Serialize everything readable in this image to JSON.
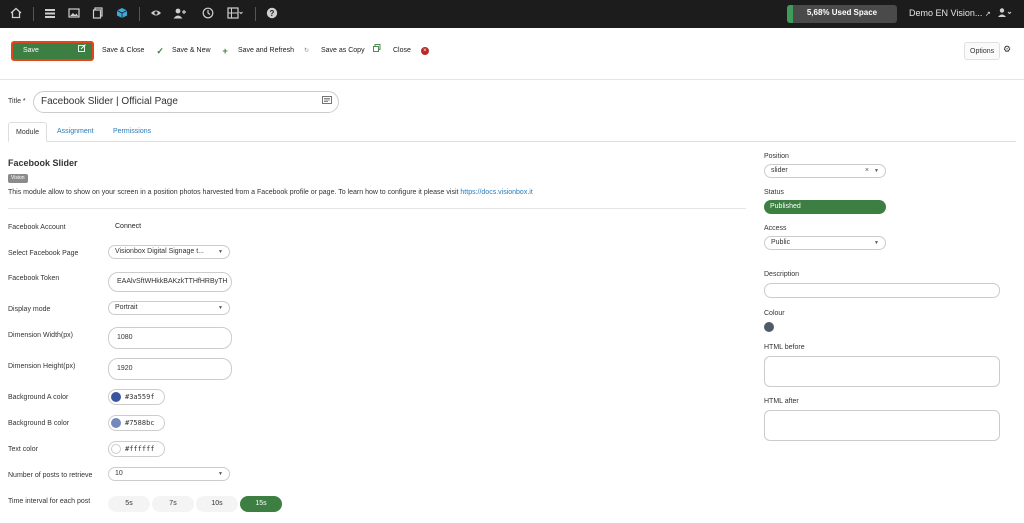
{
  "topbar": {
    "icons": [
      "home-icon",
      "list-icon",
      "image-icon",
      "copy-icon",
      "cube-icon",
      "eye-icon",
      "user-add-icon",
      "clock-icon",
      "layout-icon",
      "help-icon"
    ],
    "used_space": "5,68% Used Space",
    "used_space_percent": 5.68,
    "site_name": "Demo EN Vision...",
    "user_icon": "user-icon"
  },
  "toolbar": {
    "save": "Save",
    "save_close": "Save & Close",
    "save_new": "Save & New",
    "save_refresh": "Save and Refresh",
    "save_copy": "Save as Copy",
    "close": "Close",
    "options": "Options"
  },
  "title": {
    "label": "Title *",
    "value": "Facebook Slider | Official Page"
  },
  "tabs": [
    "Module",
    "Assignment",
    "Permissions"
  ],
  "module": {
    "heading": "Facebook Slider",
    "badge": "Vision",
    "description": "This module allow to show on your screen in a position photos harvested from a Facebook profile or page. To learn how to configure it please visit ",
    "link": "https://docs.visionbox.it"
  },
  "form": {
    "account_label": "Facebook Account",
    "account_value": "Connect",
    "page_label": "Select Facebook Page",
    "page_value": "Visionbox Digital Signage t...",
    "token_label": "Facebook Token",
    "token_value": "EAAlvSftWHkkBAKzkTTHfHRByTH",
    "display_label": "Display mode",
    "display_value": "Portrait",
    "width_label": "Dimension Width(px)",
    "width_value": "1080",
    "height_label": "Dimension Height(px)",
    "height_value": "1920",
    "bga_label": "Background A color",
    "bga_value": "#3a559f",
    "bgb_label": "Background B color",
    "bgb_value": "#7588bc",
    "text_label": "Text color",
    "text_value": "#ffffff",
    "posts_label": "Number of posts to retrieve",
    "posts_value": "10",
    "interval_label": "Time interval for each post",
    "intervals": [
      "5s",
      "7s",
      "10s",
      "15s"
    ],
    "interval_selected": "15s"
  },
  "sidebar": {
    "position_label": "Position",
    "position_value": "slider",
    "status_label": "Status",
    "status_value": "Published",
    "access_label": "Access",
    "access_value": "Public",
    "description_label": "Description",
    "colour_label": "Colour",
    "colour_value": "#4f5b66",
    "html_before_label": "HTML before",
    "html_after_label": "HTML after"
  }
}
